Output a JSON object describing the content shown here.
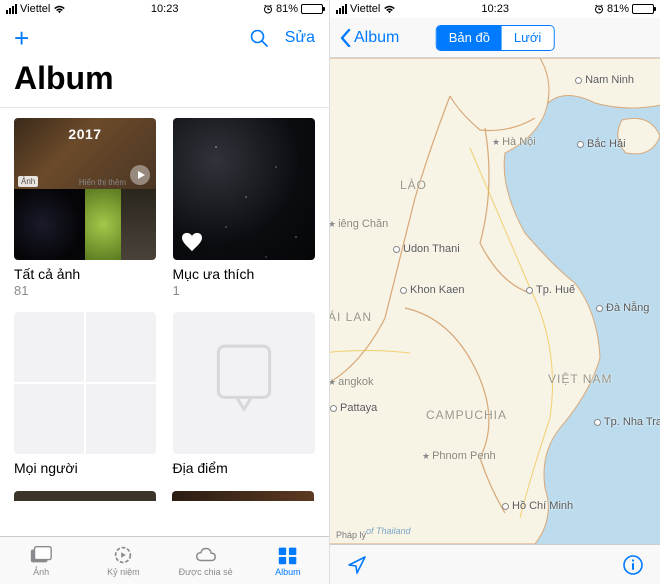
{
  "status": {
    "carrier": "Viettel",
    "time": "10:23",
    "battery_pct": "81%"
  },
  "left": {
    "edit": "Sửa",
    "title": "Album",
    "albums": {
      "all": {
        "label": "Tất cả ảnh",
        "count": "81",
        "year": "2017",
        "sub_caption_left": "Ảnh",
        "sub_caption_right": "Hiển thị thêm"
      },
      "fav": {
        "label": "Mục ưa thích",
        "count": "1"
      },
      "people": {
        "label": "Mọi người"
      },
      "places": {
        "label": "Địa điểm"
      }
    },
    "tabs": {
      "photos": "Ảnh",
      "memories": "Kỷ niệm",
      "shared": "Được chia sẻ",
      "albums": "Album"
    }
  },
  "right": {
    "back": "Album",
    "seg": {
      "map": "Bản đồ",
      "grid": "Lưới"
    },
    "legal": "Pháp lý",
    "labels": {
      "ha_noi": "Hà Nội",
      "bac_hai": "Bắc Hải",
      "nam_ninh": "Nam Ninh",
      "lao": "LÀO",
      "viengchan": "iêng Chăn",
      "udon": "Udon Thani",
      "khonkaen": "Khon Kaen",
      "hue": "Tp. Huế",
      "danang": "Đà Nẵng",
      "thailand": "ÁI LAN",
      "vietnam": "VIỆT NAM",
      "bangkok": "angkok",
      "pattaya": "Pattaya",
      "campuchia": "CAMPUCHIA",
      "nhatrang": "Tp. Nha Tra",
      "phnom": "Phnom Penh",
      "hcm": "Hồ Chí Minh",
      "gulf": "of Thailand"
    }
  }
}
